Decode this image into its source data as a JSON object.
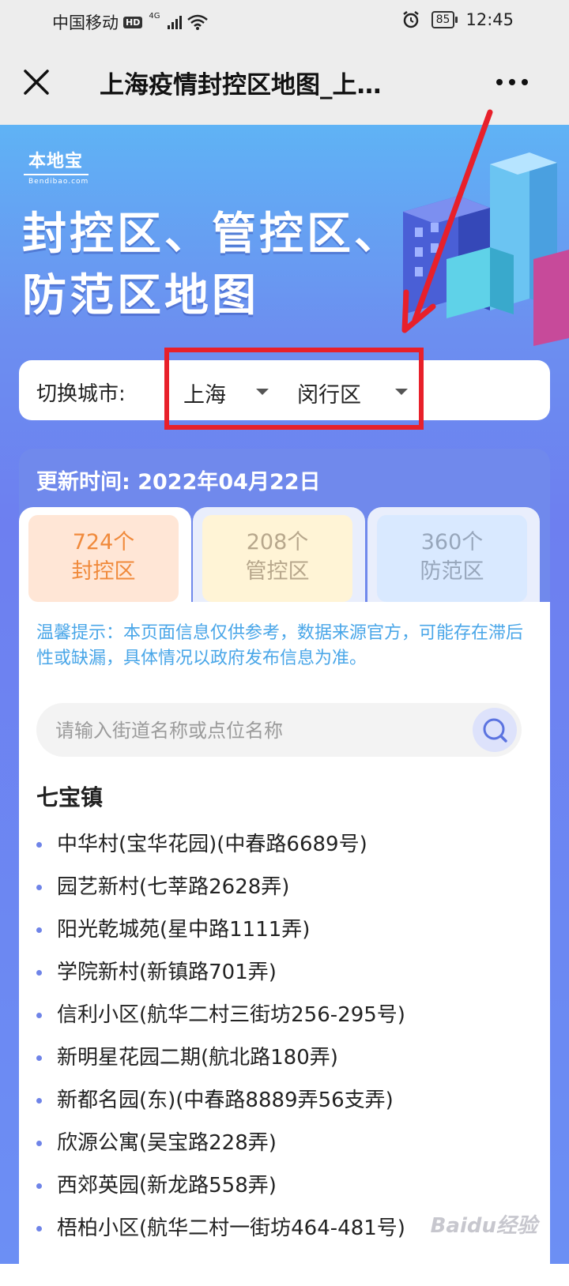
{
  "status_bar": {
    "carrier": "中国移动",
    "hd": "HD",
    "network": "4G",
    "battery": "85",
    "time": "12:45"
  },
  "title_bar": {
    "title": "上海疫情封控区地图_上…"
  },
  "logo": {
    "name": "本地宝",
    "sub": "Bendibao.com"
  },
  "hero": {
    "line1": "封控区、管控区、",
    "line2": "防范区地图"
  },
  "city_switcher": {
    "label": "切换城市:",
    "city": "上海",
    "district": "闵行区"
  },
  "update": {
    "label": "更新时间:",
    "date": "2022年04月22日"
  },
  "tabs": [
    {
      "count": "724个",
      "name": "封控区"
    },
    {
      "count": "208个",
      "name": "管控区"
    },
    {
      "count": "360个",
      "name": "防范区"
    }
  ],
  "tip": "温馨提示：本页面信息仅供参考，数据来源官方，可能存在滞后性或缺漏，具体情况以政府发布信息为准。",
  "search": {
    "placeholder": "请输入街道名称或点位名称"
  },
  "group": {
    "title": "七宝镇",
    "items": [
      "中华村(宝华花园)(中春路6689号)",
      "园艺新村(七莘路2628弄)",
      "阳光乾城苑(星中路1111弄)",
      "学院新村(新镇路701弄)",
      "信利小区(航华二村三街坊256-295号)",
      "新明星花园二期(航北路180弄)",
      "新都名园(东)(中春路8889弄56支弄)",
      "欣源公寓(吴宝路228弄)",
      "西郊英园(新龙路558弄)",
      "梧柏小区(航华二村一街坊464-481号)"
    ]
  },
  "watermark": "Baidu经验",
  "colors": {
    "annotation_red": "#e8202a",
    "hero_blue": "#6c8ff0",
    "tip_blue": "#49a6e8",
    "tab_orange": "#f08a3c"
  }
}
